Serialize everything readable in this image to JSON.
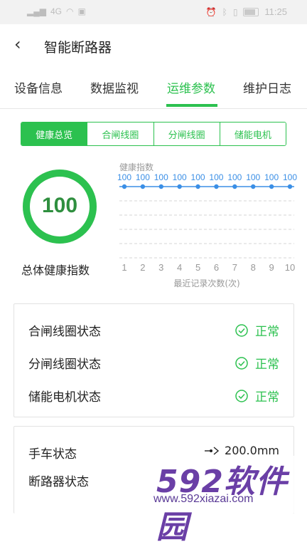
{
  "status_bar": {
    "signal_text": "4G",
    "time": "11:25",
    "icons": [
      "signal-icon",
      "wifi-icon",
      "nfc-icon",
      "alarm-icon",
      "bluetooth-icon",
      "vibrate-icon",
      "battery-icon"
    ]
  },
  "header": {
    "back_icon": "chevron-left-icon",
    "title": "智能断路器"
  },
  "tabs": [
    {
      "label": "设备信息",
      "active": false
    },
    {
      "label": "数据监视",
      "active": false
    },
    {
      "label": "运维参数",
      "active": true
    },
    {
      "label": "维护日志",
      "active": false
    }
  ],
  "segments": [
    {
      "label": "健康总览",
      "active": true
    },
    {
      "label": "合闸线圈",
      "active": false
    },
    {
      "label": "分闸线圈",
      "active": false
    },
    {
      "label": "储能电机",
      "active": false
    }
  ],
  "health": {
    "value": "100",
    "level_percent": 100,
    "label": "总体健康指数"
  },
  "chart_data": {
    "type": "line",
    "ylabel": "健康指数",
    "xlabel": "最近记录次数(次)",
    "x": [
      1,
      2,
      3,
      4,
      5,
      6,
      7,
      8,
      9,
      10
    ],
    "series": [
      {
        "values": [
          100,
          100,
          100,
          100,
          100,
          100,
          100,
          100,
          100,
          100
        ]
      }
    ],
    "data_labels": [
      "100",
      "100",
      "100",
      "100",
      "100",
      "100",
      "100",
      "100",
      "100",
      "100"
    ],
    "ylim": [
      0,
      100
    ],
    "grid": true,
    "color": "#3b8fe6"
  },
  "status_card": {
    "rows": [
      {
        "label": "合闸线圈状态",
        "status": "正常",
        "icon": "check-circle-icon"
      },
      {
        "label": "分闸线圈状态",
        "status": "正常",
        "icon": "check-circle-icon"
      },
      {
        "label": "储能电机状态",
        "status": "正常",
        "icon": "check-circle-icon"
      }
    ]
  },
  "device_card": {
    "rows": [
      {
        "label": "手车状态",
        "value": "200.0mm",
        "icon": "connector-icon"
      },
      {
        "label": "断路器状态",
        "value": ""
      }
    ]
  },
  "watermark": {
    "logo": "592软件园",
    "url": "www.592xiazai.com"
  },
  "colors": {
    "accent": "#2cc14f",
    "chart_line": "#3b8fe6",
    "gauge_text": "#2f8f3f"
  }
}
